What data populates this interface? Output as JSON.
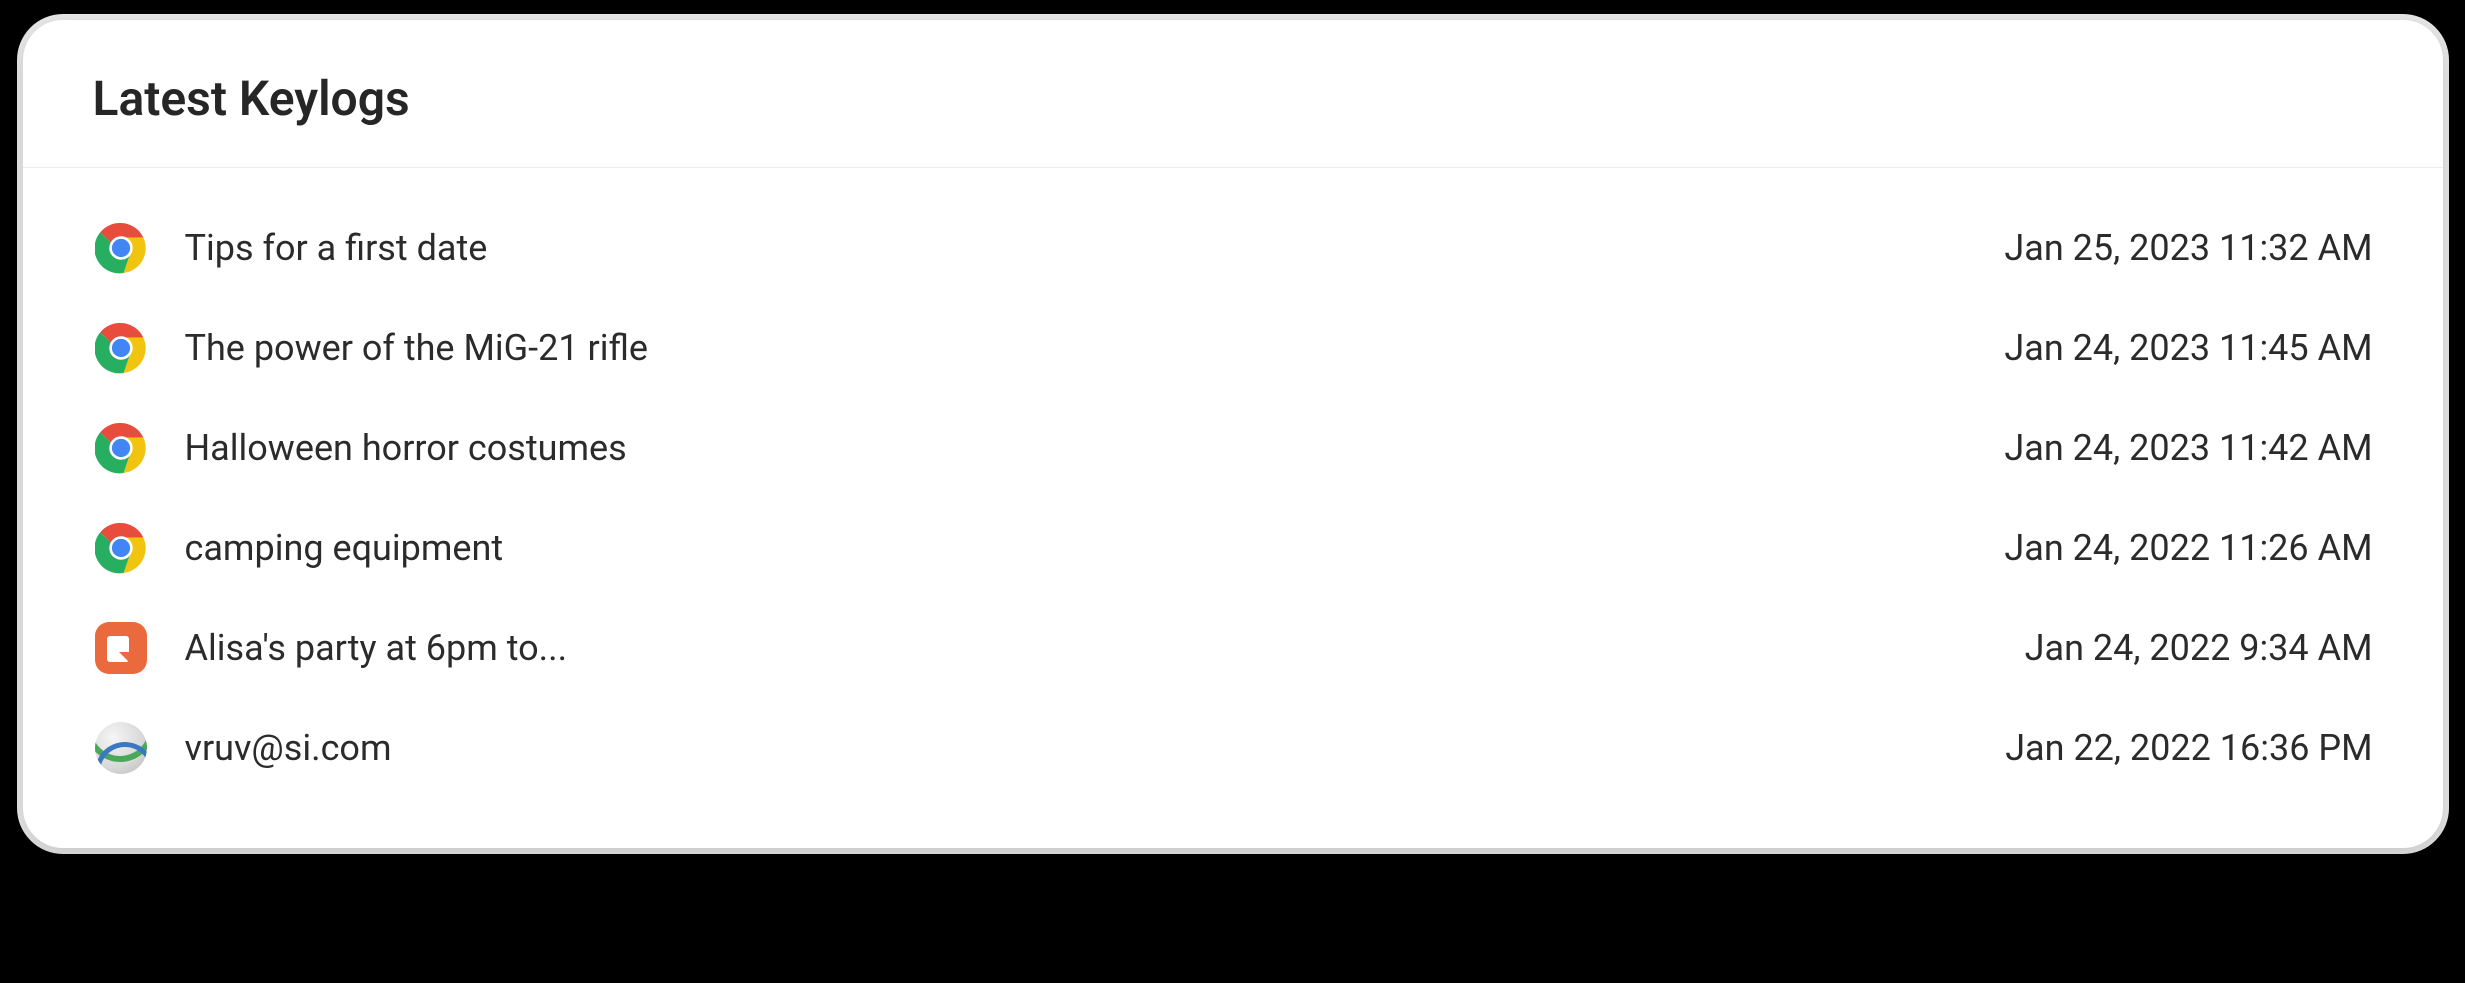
{
  "header": {
    "title": "Latest Keylogs"
  },
  "rows": [
    {
      "icon": "chrome",
      "text": "Tips for a first date",
      "time": "Jan 25, 2023 11:32 AM"
    },
    {
      "icon": "chrome",
      "text": "The power of the MiG-21 rifle",
      "time": "Jan 24, 2023 11:45 AM"
    },
    {
      "icon": "chrome",
      "text": "Halloween horror costumes",
      "time": "Jan 24, 2023 11:42 AM"
    },
    {
      "icon": "chrome",
      "text": "camping equipment",
      "time": "Jan 24, 2022 11:26 AM"
    },
    {
      "icon": "notes",
      "text": "Alisa's party at 6pm to...",
      "time": "Jan 24, 2022 9:34 AM"
    },
    {
      "icon": "globe",
      "text": "vruv@si.com",
      "time": "Jan 22, 2022 16:36 PM"
    }
  ]
}
